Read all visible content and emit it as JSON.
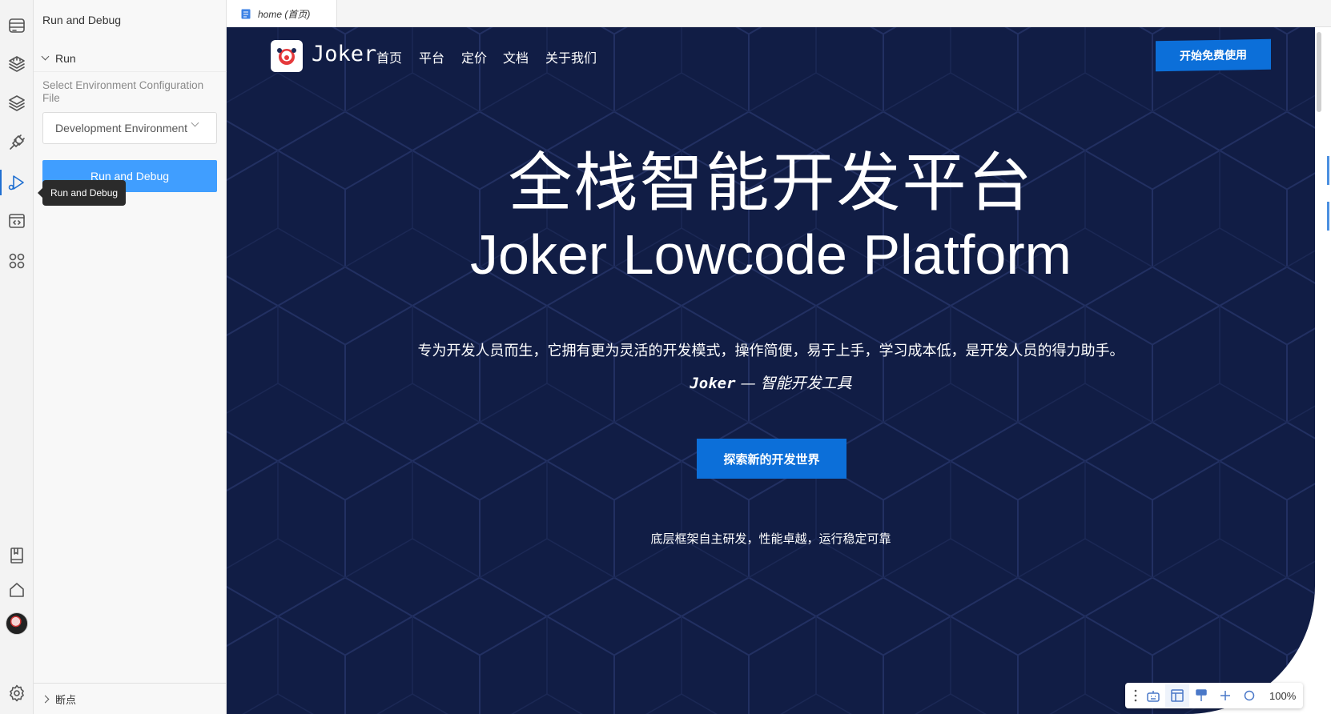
{
  "sidebar": {
    "title": "Run and Debug",
    "run_section": "Run",
    "env_label": "Select Environment Configuration File",
    "env_selected": "Development Environment",
    "run_button": "Run and Debug",
    "tooltip": "Run and Debug",
    "breakpoints": "断点"
  },
  "activity_bar": {
    "icons": [
      "database-icon",
      "stack-icon",
      "layers-icon",
      "plug-icon",
      "run-debug-icon",
      "code-window-icon",
      "apps-icon",
      "book-icon",
      "home-icon",
      "avatar",
      "gear-icon"
    ],
    "active": "run-debug-icon"
  },
  "tab": {
    "label": "home (首页)"
  },
  "site": {
    "brand": "Joker",
    "nav": [
      "首页",
      "平台",
      "定价",
      "文档",
      "关于我们"
    ],
    "cta_top": "开始免费使用",
    "headline_cn": "全栈智能开发平台",
    "headline_en": "Joker Lowcode Platform",
    "description": "专为开发人员而生，它拥有更为灵活的开发模式，操作简便，易于上手，学习成本低，是开发人员的得力助手。",
    "slogan_brand": "Joker",
    "slogan_rest": " — 智能开发工具",
    "explore_button": "探索新的开发世界",
    "feature_line": "底层框架自主研发，性能卓越，运行稳定可靠"
  },
  "zoombar": {
    "zoom": "100%"
  },
  "colors": {
    "accent": "#409eff",
    "site_bg": "#111d45",
    "site_button": "#0c6fd9"
  }
}
